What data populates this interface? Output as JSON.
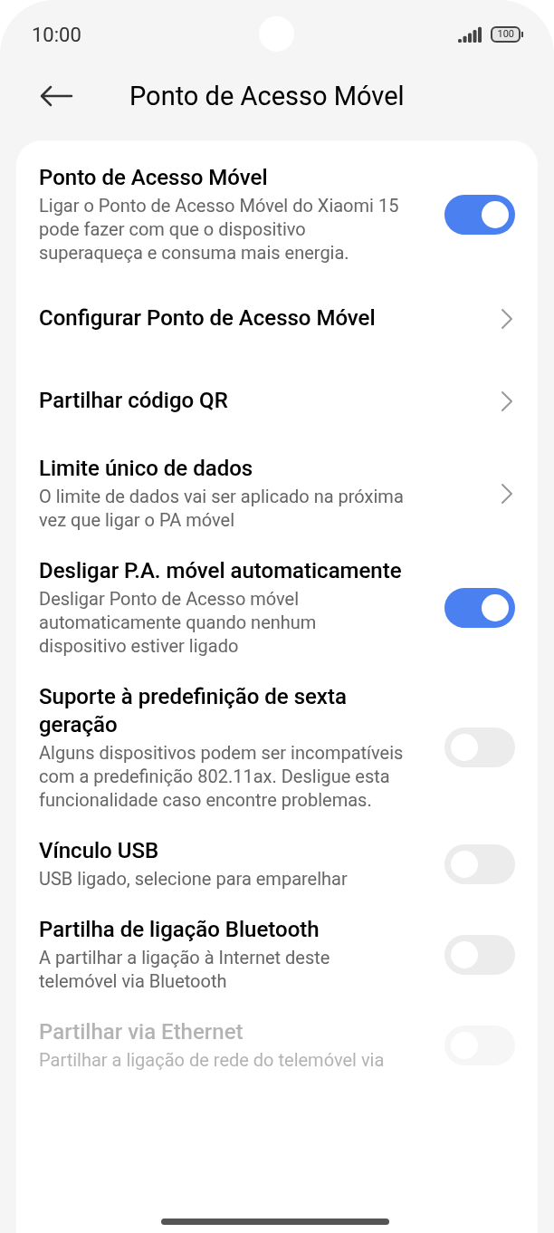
{
  "status_bar": {
    "time": "10:00",
    "battery": "100"
  },
  "header": {
    "title": "Ponto de Acesso Móvel"
  },
  "settings": [
    {
      "kind": "switch",
      "title": "Ponto de Acesso Móvel",
      "description": "Ligar o Ponto de Acesso Móvel do Xiaomi 15 pode fazer com que o dispositivo superaqueça e consuma mais energia.",
      "on": true,
      "disabled": false
    },
    {
      "kind": "link",
      "title": "Configurar Ponto de Acesso Móvel"
    },
    {
      "kind": "link",
      "title": "Partilhar código QR"
    },
    {
      "kind": "link",
      "title": "Limite único de dados",
      "description": "O limite de dados vai ser aplicado na próxima vez que ligar o PA móvel"
    },
    {
      "kind": "switch",
      "title": "Desligar P.A. móvel automaticamente",
      "description": "Desligar Ponto de Acesso móvel automaticamente quando nenhum dispositivo estiver ligado",
      "on": true,
      "disabled": false
    },
    {
      "kind": "switch",
      "title": "Suporte à predefinição de sexta geração",
      "description": "Alguns dispositivos podem ser incompatíveis com a predefinição 802.11ax. Desligue esta funcionalidade caso encontre problemas.",
      "on": false,
      "disabled": false
    },
    {
      "kind": "switch",
      "title": "Vínculo USB",
      "description": "USB ligado, selecione para emparelhar",
      "on": false,
      "disabled": false
    },
    {
      "kind": "switch",
      "title": "Partilha de ligação Bluetooth",
      "description": "A partilhar a ligação à Internet deste telemóvel via Bluetooth",
      "on": false,
      "disabled": false
    },
    {
      "kind": "switch",
      "title": "Partilhar via Ethernet",
      "description": "Partilhar a ligação de rede do telemóvel via",
      "on": false,
      "disabled": true
    }
  ]
}
